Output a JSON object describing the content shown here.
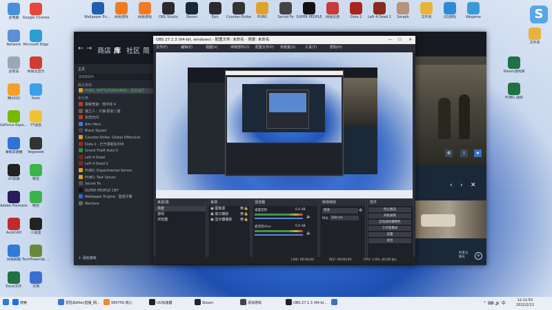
{
  "desktop": {
    "left_icons": [
      {
        "label": "此电脑",
        "color": "#4a90d9"
      },
      {
        "label": "Google Chrome",
        "color": "#e8453c"
      },
      {
        "label": "Network",
        "color": "#5b8fd6"
      },
      {
        "label": "Microsoft Edge",
        "color": "#2a9fd6"
      },
      {
        "label": "回收站",
        "color": "#9aa7b8"
      },
      {
        "label": "网易云音乐",
        "color": "#d33a31"
      },
      {
        "label": "腾讯QQ",
        "color": "#f2a02a"
      },
      {
        "label": "Kook",
        "color": "#3aa0e8"
      },
      {
        "label": "GeForce Experience",
        "color": "#76b900"
      },
      {
        "label": "YY语音",
        "color": "#f1c232"
      },
      {
        "label": "海龟加速器",
        "color": "#2d74d6"
      },
      {
        "label": "Vegaseek",
        "color": "#333333"
      },
      {
        "label": "UU加速",
        "color": "#222222"
      },
      {
        "label": "微信",
        "color": "#3bb44a"
      },
      {
        "label": "Adobe Premiere",
        "color": "#2a1a5e"
      },
      {
        "label": "微信",
        "color": "#3bb44a"
      },
      {
        "label": "AutoCAD",
        "color": "#c22a2a"
      },
      {
        "label": "小黑盒",
        "color": "#222222"
      },
      {
        "label": "网易邮箱",
        "color": "#2f7bd6"
      },
      {
        "label": "TechPowerUp GPU-Z",
        "color": "#6a8a3a"
      },
      {
        "label": "Excel文件",
        "color": "#1f7244"
      },
      {
        "label": "文档",
        "color": "#3a6fd0"
      }
    ],
    "top_icons": [
      {
        "label": "Wallpaper Engine",
        "color": "#1e5fb0"
      },
      {
        "label": "网易游戏",
        "color": "#f07a22"
      },
      {
        "label": "网易游戏",
        "color": "#f07a22"
      },
      {
        "label": "OBS Studio",
        "color": "#2b2b2b"
      },
      {
        "label": "Steam",
        "color": "#1b2838"
      },
      {
        "label": "Epic",
        "color": "#2a2a2a"
      },
      {
        "label": "Counter-Strike",
        "color": "#333333"
      },
      {
        "label": "PUBG",
        "color": "#e0a32a"
      },
      {
        "label": "Secret Fe",
        "color": "#444444"
      },
      {
        "label": "SUPER PEOPLE",
        "color": "#111111"
      },
      {
        "label": "网易云游",
        "color": "#c83a3a"
      },
      {
        "label": "Dota 2",
        "color": "#a8261c"
      },
      {
        "label": "Left 4 Dead 2",
        "color": "#8a2a1c"
      },
      {
        "label": "Seraph",
        "color": "#b89080"
      },
      {
        "label": "文件夹",
        "color": "#e8b33a"
      },
      {
        "label": "QQ游戏",
        "color": "#2f8ad6"
      },
      {
        "label": "Wegame",
        "color": "#3a9ad8"
      }
    ],
    "right_icons": [
      {
        "label": "Steam游戏库",
        "color": "#1f7244"
      },
      {
        "label": "PUBG 战绩",
        "color": "#1f7244"
      },
      {
        "label": "文件夹",
        "color": "#e8b33a"
      }
    ]
  },
  "steam": {
    "title": "Steam",
    "nav": {
      "store": "商店",
      "library": "库",
      "community": "社区",
      "username": "简"
    },
    "side": {
      "home": "主页",
      "search_placeholder": "游戏和软件",
      "recent_header": "最近游戏",
      "selected_game": "PUBG: BATTLEGROUNDS - 正在运行",
      "all_header": "未分类",
      "games": [
        {
          "name": "极致竞速：地平线 4",
          "color": "#c0392b"
        },
        {
          "name": "独立人：只狼·影逝二度",
          "color": "#7b5a3a"
        },
        {
          "name": "永劫无间",
          "color": "#c0392b"
        },
        {
          "name": "Aim Hero",
          "color": "#3a7bd5"
        },
        {
          "name": "Black Squad",
          "color": "#444444"
        },
        {
          "name": "Counter-Strike: Global Offensive",
          "color": "#d89a2a"
        },
        {
          "name": "Dota 2 - 已于更新队列中",
          "color": "#a8261c"
        },
        {
          "name": "Grand Theft Auto V",
          "color": "#3a8a3a"
        },
        {
          "name": "Left 4 Dead",
          "color": "#7a2a1a"
        },
        {
          "name": "Left 4 Dead 2",
          "color": "#8a2a1a"
        },
        {
          "name": "PUBG: Experimental Server",
          "color": "#d8a22a"
        },
        {
          "name": "PUBG: Test Server",
          "color": "#d8a22a"
        },
        {
          "name": "Secret Fe",
          "color": "#555555"
        },
        {
          "name": "SUPER PEOPLE CBT",
          "color": "#111111"
        },
        {
          "name": "Wallpaper Engine：壁纸引擎",
          "color": "#2a6ad0"
        },
        {
          "name": "Warface",
          "color": "#666666"
        }
      ],
      "add_game": "添加游戏"
    },
    "right": {
      "friends": "好友与\n聊天"
    }
  },
  "obs": {
    "title": "OBS 27.1.3 (64-bit, windows) - 配置文件: 未命名 - 场景: 未命名",
    "menu": [
      "文件(F)",
      "编辑(E)",
      "视图(V)",
      "停靠部件(D)",
      "配置文件(P)",
      "场景集(S)",
      "工具(T)",
      "帮助(H)"
    ],
    "scenes_header": "来源/源",
    "scene_list": [
      "场景",
      "游戏",
      "浏览器"
    ],
    "sources_header": "来源",
    "source_items": [
      "",
      "图像源",
      "",
      "窗口捕获",
      "",
      "显示器捕获"
    ],
    "mixer_header": "混音器",
    "mixer_tracks": [
      {
        "name": "桌面音频",
        "level": "0.0 dB"
      },
      {
        "name": "麦克风/Aux",
        "level": "0.0 dB"
      }
    ],
    "transition_header": "转场特效",
    "transition_value": "渐变",
    "duration_label": "时长",
    "duration_value": "300 ms",
    "controls_header": "控件",
    "controls": [
      "停止推流",
      "开始录制",
      "启动虚拟摄像机",
      "工作室模式",
      "设置",
      "退出"
    ],
    "status": {
      "live": "LIVE: 00:00:00",
      "rec": "REC: 00:00:00",
      "cpu": "CPU: 1.0%, 60.00 fps"
    }
  },
  "taskbar": {
    "items": [
      {
        "label": "搜索",
        "color": "#1a73e8"
      },
      {
        "label": "冒险岛Allen直播_网...",
        "color": "#2f7bd6"
      },
      {
        "label": "580755-核心",
        "color": "#f08a2a"
      },
      {
        "label": "UU加速器",
        "color": "#222222"
      },
      {
        "label": "Steam",
        "color": "#1b2838"
      },
      {
        "label": "添加游戏",
        "color": "#444444"
      },
      {
        "label": "OBS 27.1.3 (64-bi...",
        "color": "#222222"
      },
      {
        "label": "",
        "color": "#3a6fd0"
      }
    ],
    "time": "12:11:50",
    "date": "2022/2/13"
  }
}
